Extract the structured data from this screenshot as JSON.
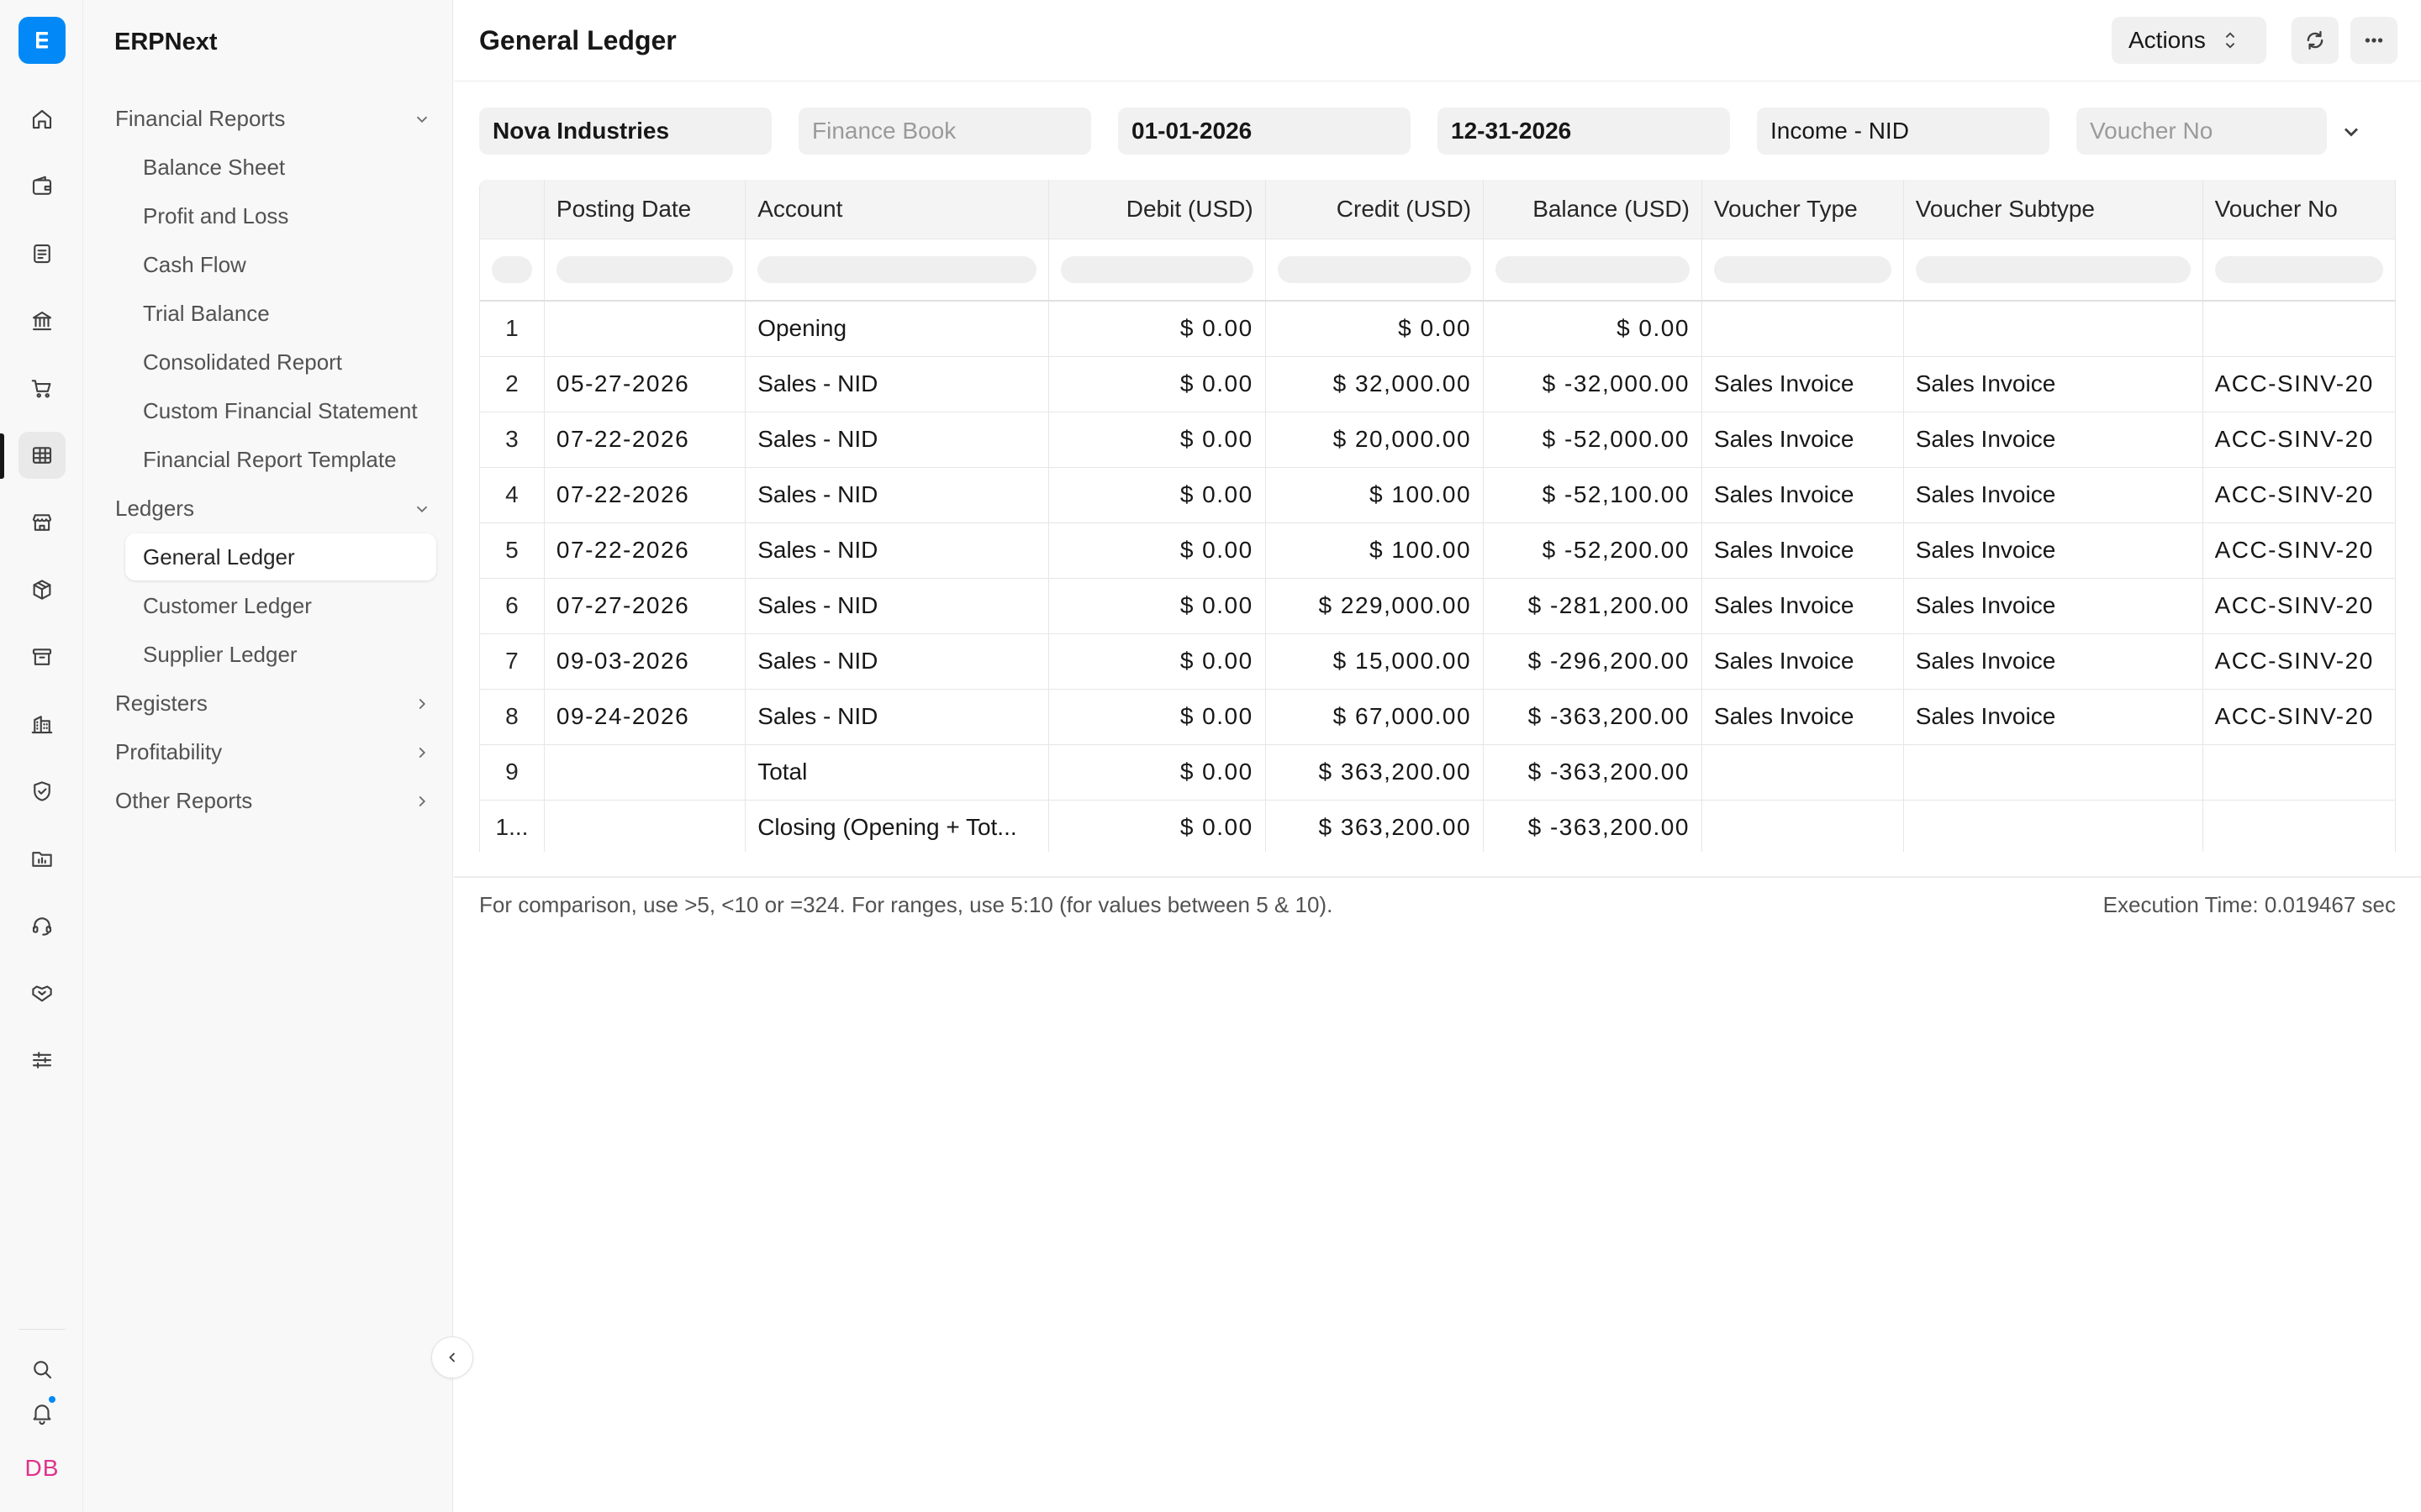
{
  "app": {
    "name": "ERPNext",
    "logo_letter": "E",
    "accent": "#0289f7"
  },
  "rail": {
    "icons": [
      "home-icon",
      "wallet-icon",
      "receipt-icon",
      "bank-icon",
      "cart-icon",
      "table-icon",
      "store-icon",
      "box-icon",
      "archive-icon",
      "building-icon",
      "shield-icon",
      "folder-chart-icon",
      "headset-icon",
      "handshake-icon",
      "sliders-icon"
    ],
    "active": "table-icon",
    "avatar_initials": "DB",
    "avatar_color": "#e0338c"
  },
  "sidebar": {
    "groups": [
      {
        "label": "Financial Reports",
        "expanded": true,
        "items": [
          "Balance Sheet",
          "Profit and Loss",
          "Cash Flow",
          "Trial Balance",
          "Consolidated Report",
          "Custom Financial Statement",
          "Financial Report Template"
        ]
      },
      {
        "label": "Ledgers",
        "expanded": true,
        "items": [
          "General Ledger",
          "Customer Ledger",
          "Supplier Ledger"
        ]
      },
      {
        "label": "Registers",
        "expanded": false,
        "items": []
      },
      {
        "label": "Profitability",
        "expanded": false,
        "items": []
      },
      {
        "label": "Other Reports",
        "expanded": false,
        "items": []
      }
    ],
    "active_item": "General Ledger"
  },
  "header": {
    "title": "General Ledger",
    "actions_label": "Actions"
  },
  "filters": {
    "company": "Nova Industries",
    "finance_book_placeholder": "Finance Book",
    "from_date": "01-01-2026",
    "to_date": "12-31-2026",
    "account": "Income - NID",
    "voucher_no_placeholder": "Voucher No"
  },
  "table": {
    "columns": [
      "",
      "Posting Date",
      "Account",
      "Debit (USD)",
      "Credit (USD)",
      "Balance (USD)",
      "Voucher Type",
      "Voucher Subtype",
      "Voucher No"
    ],
    "rows": [
      {
        "n": "1",
        "date": "",
        "account": "Opening",
        "debit": "$ 0.00",
        "credit": "$ 0.00",
        "balance": "$ 0.00",
        "vtype": "",
        "vsub": "",
        "vno": ""
      },
      {
        "n": "2",
        "date": "05-27-2026",
        "account": "Sales - NID",
        "debit": "$ 0.00",
        "credit": "$ 32,000.00",
        "balance": "$ -32,000.00",
        "vtype": "Sales Invoice",
        "vsub": "Sales Invoice",
        "vno": "ACC-SINV-20"
      },
      {
        "n": "3",
        "date": "07-22-2026",
        "account": "Sales - NID",
        "debit": "$ 0.00",
        "credit": "$ 20,000.00",
        "balance": "$ -52,000.00",
        "vtype": "Sales Invoice",
        "vsub": "Sales Invoice",
        "vno": "ACC-SINV-20"
      },
      {
        "n": "4",
        "date": "07-22-2026",
        "account": "Sales - NID",
        "debit": "$ 0.00",
        "credit": "$ 100.00",
        "balance": "$ -52,100.00",
        "vtype": "Sales Invoice",
        "vsub": "Sales Invoice",
        "vno": "ACC-SINV-20"
      },
      {
        "n": "5",
        "date": "07-22-2026",
        "account": "Sales - NID",
        "debit": "$ 0.00",
        "credit": "$ 100.00",
        "balance": "$ -52,200.00",
        "vtype": "Sales Invoice",
        "vsub": "Sales Invoice",
        "vno": "ACC-SINV-20"
      },
      {
        "n": "6",
        "date": "07-27-2026",
        "account": "Sales - NID",
        "debit": "$ 0.00",
        "credit": "$ 229,000.00",
        "balance": "$ -281,200.00",
        "vtype": "Sales Invoice",
        "vsub": "Sales Invoice",
        "vno": "ACC-SINV-20"
      },
      {
        "n": "7",
        "date": "09-03-2026",
        "account": "Sales - NID",
        "debit": "$ 0.00",
        "credit": "$ 15,000.00",
        "balance": "$ -296,200.00",
        "vtype": "Sales Invoice",
        "vsub": "Sales Invoice",
        "vno": "ACC-SINV-20"
      },
      {
        "n": "8",
        "date": "09-24-2026",
        "account": "Sales - NID",
        "debit": "$ 0.00",
        "credit": "$ 67,000.00",
        "balance": "$ -363,200.00",
        "vtype": "Sales Invoice",
        "vsub": "Sales Invoice",
        "vno": "ACC-SINV-20"
      },
      {
        "n": "9",
        "date": "",
        "account": "Total",
        "debit": "$ 0.00",
        "credit": "$ 363,200.00",
        "balance": "$ -363,200.00",
        "vtype": "",
        "vsub": "",
        "vno": ""
      },
      {
        "n": "1...",
        "date": "",
        "account": "Closing (Opening + Tot...",
        "debit": "$ 0.00",
        "credit": "$ 363,200.00",
        "balance": "$ -363,200.00",
        "vtype": "",
        "vsub": "",
        "vno": ""
      }
    ]
  },
  "footer": {
    "hint": "For comparison, use >5, <10 or =324. For ranges, use 5:10 (for values between 5 & 10).",
    "execution_time": "Execution Time: 0.019467 sec"
  }
}
